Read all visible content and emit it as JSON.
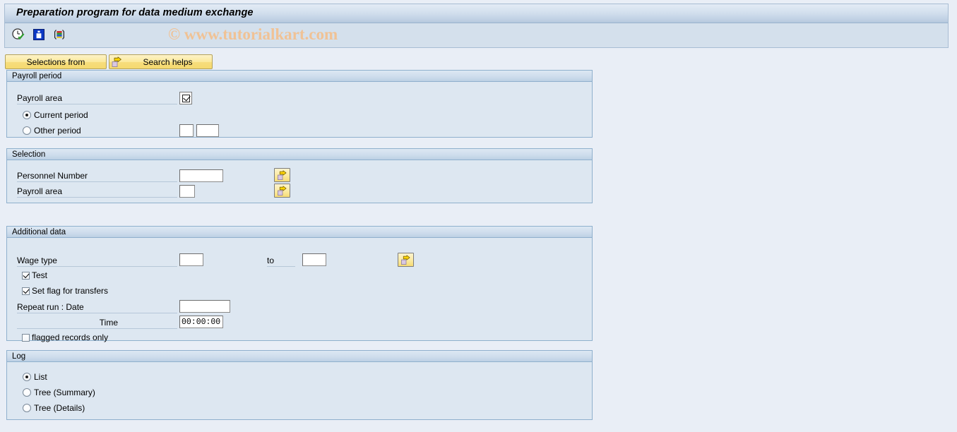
{
  "window": {
    "title": "Preparation program for data medium exchange"
  },
  "watermark": {
    "text": "© www.tutorialkart.com",
    "color": "#f0c295"
  },
  "toolbar": {
    "icons": [
      {
        "name": "execute-clock-icon",
        "title": "Execute / Schedule"
      },
      {
        "name": "info-icon",
        "title": "Program documentation"
      },
      {
        "name": "variant-icon",
        "title": "Get variant"
      }
    ]
  },
  "action_buttons": [
    {
      "name": "selections-from-button",
      "label": "Selections from",
      "icon": null
    },
    {
      "name": "search-helps-button",
      "label": "Search helps",
      "icon": "arrow-right-icon"
    }
  ],
  "sections": {
    "payroll_period": {
      "title": "Payroll period",
      "payroll_area_label": "Payroll area",
      "payroll_area_checkbox": {
        "name": "payroll-area-toggle",
        "checked": true
      },
      "options": [
        {
          "name": "current-period-radio",
          "label": "Current period",
          "selected": true
        },
        {
          "name": "other-period-radio",
          "label": "Other period",
          "selected": false
        }
      ],
      "other_period_fields": [
        {
          "name": "other-period-field-1",
          "value": "",
          "placeholder": ""
        },
        {
          "name": "other-period-field-2",
          "value": "",
          "placeholder": ""
        }
      ]
    },
    "selection": {
      "title": "Selection",
      "rows": [
        {
          "label": "Personnel Number",
          "input_name": "personnel-number-input",
          "value": "",
          "placeholder": "",
          "multi_button": "personnel-number-multiple-selection-button"
        },
        {
          "label": "Payroll area",
          "input_name": "payroll-area-input",
          "value": "",
          "placeholder": "",
          "multi_button": "payroll-area-multiple-selection-button"
        }
      ]
    },
    "additional_data": {
      "title": "Additional data",
      "wage_type_label": "Wage type",
      "wage_type_from": {
        "name": "wage-type-from-input",
        "value": "",
        "placeholder": ""
      },
      "to_label": "to",
      "wage_type_to": {
        "name": "wage-type-to-input",
        "value": "",
        "placeholder": ""
      },
      "wage_type_multi_button": "wage-type-multiple-selection-button",
      "checkboxes": [
        {
          "name": "test-checkbox",
          "label": "Test",
          "checked": true
        },
        {
          "name": "set-flag-for-transfers-checkbox",
          "label": "Set flag for transfers",
          "checked": true
        },
        {
          "name": "flagged-records-only-checkbox",
          "label": "flagged records only",
          "checked": false
        }
      ],
      "repeat_run_label": "Repeat run      : Date",
      "repeat_run_date": {
        "name": "repeat-run-date-input",
        "value": "",
        "placeholder": ""
      },
      "time_label": "Time",
      "repeat_run_time": {
        "name": "repeat-run-time-input",
        "value": "00:00:00",
        "placeholder": ""
      }
    },
    "log": {
      "title": "Log",
      "options": [
        {
          "name": "log-list-radio",
          "label": "List",
          "selected": true
        },
        {
          "name": "log-tree-summary-radio",
          "label": "Tree (Summary)",
          "selected": false
        },
        {
          "name": "log-tree-details-radio",
          "label": "Tree (Details)",
          "selected": false
        }
      ]
    }
  }
}
